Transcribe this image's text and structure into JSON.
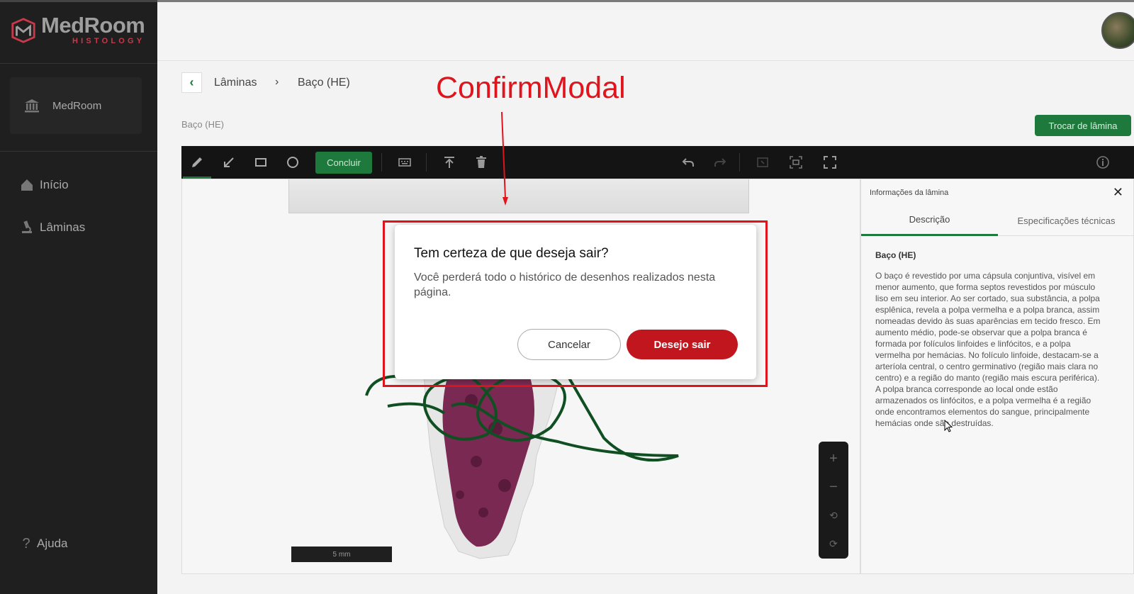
{
  "app": {
    "logo_main": "MedRoom",
    "logo_sub": "HISTOLOGY",
    "brand_accent": "#c8394a",
    "primary_color": "#1e7a3c",
    "danger_color": "#c2161f"
  },
  "sidebar": {
    "org_label": "MedRoom",
    "items": [
      {
        "label": "Início",
        "icon": "home-icon"
      },
      {
        "label": "Lâminas",
        "icon": "microscope-icon"
      }
    ],
    "help_label": "Ajuda"
  },
  "breadcrumb": {
    "items": [
      "Lâminas",
      "Baço (HE)"
    ],
    "separator": "›"
  },
  "page": {
    "slide_title": "Baço (HE)",
    "change_slide_button": "Trocar de lâmina"
  },
  "toolbar": {
    "finish_label": "Concluir",
    "tools": [
      "pencil-icon",
      "arrow-icon",
      "rectangle-icon",
      "circle-icon",
      "keyboard-icon",
      "upload-icon",
      "trash-icon",
      "undo-icon",
      "redo-icon",
      "crop-icon",
      "screenshot-icon",
      "fullscreen-icon",
      "info-icon"
    ]
  },
  "viewer": {
    "scale_label": "5 mm",
    "zoom_controls": [
      "+",
      "−"
    ]
  },
  "info_panel": {
    "header": "Informações da lâmina",
    "tabs": [
      "Descrição",
      "Especificações técnicas"
    ],
    "active_tab": "Descrição",
    "desc_title": "Baço (HE)",
    "desc_body": "O baço é revestido por uma cápsula conjuntiva, visível em menor aumento, que forma septos revestidos por músculo liso em seu interior. Ao ser cortado, sua substância, a polpa esplênica, revela a polpa vermelha e a polpa branca, assim nomeadas devido às suas aparências em tecido fresco. Em aumento médio, pode-se observar que a polpa branca é formada por folículos linfoides e linfócitos, e a polpa vermelha por hemácias. No folículo linfoide, destacam-se a arteríola central, o centro germinativo (região mais clara no centro) e a região do manto (região mais escura periférica). A polpa branca corresponde ao local onde estão armazenados os linfócitos, e a polpa vermelha é a região onde encontramos elementos do sangue, principalmente hemácias onde são destruídas."
  },
  "modal": {
    "title": "Tem certeza de que deseja sair?",
    "message": "Você perderá todo o histórico de desenhos realizados nesta página.",
    "cancel_label": "Cancelar",
    "confirm_label": "Desejo sair"
  },
  "annotation": {
    "label": "ConfirmModal",
    "color": "#e0141c"
  }
}
